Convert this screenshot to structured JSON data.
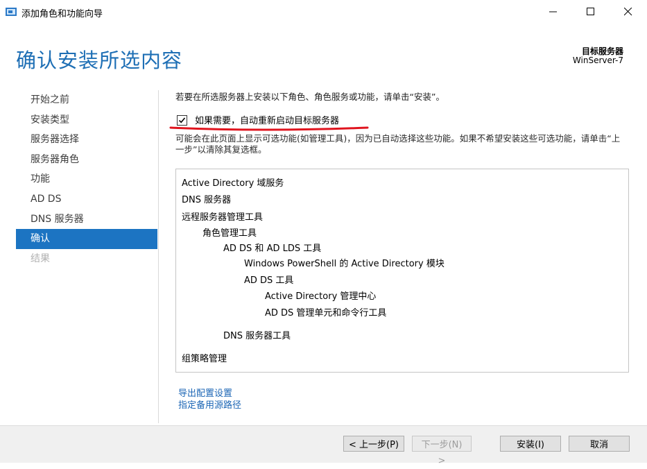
{
  "window": {
    "title": "添加角色和功能向导"
  },
  "header": {
    "page_title": "确认安装所选内容",
    "target_label": "目标服务器",
    "target_value": "WinServer-7"
  },
  "nav": {
    "items": [
      {
        "label": "开始之前",
        "state": "normal"
      },
      {
        "label": "安装类型",
        "state": "normal"
      },
      {
        "label": "服务器选择",
        "state": "normal"
      },
      {
        "label": "服务器角色",
        "state": "normal"
      },
      {
        "label": "功能",
        "state": "normal"
      },
      {
        "label": "AD DS",
        "state": "normal"
      },
      {
        "label": "DNS 服务器",
        "state": "normal"
      },
      {
        "label": "确认",
        "state": "active"
      },
      {
        "label": "结果",
        "state": "disabled"
      }
    ]
  },
  "main": {
    "intro": "若要在所选服务器上安装以下角色、角色服务或功能，请单击“安装”。",
    "restart_checkbox": {
      "label": "如果需要，自动重新启动目标服务器",
      "checked": true
    },
    "note": "可能会在此页面上显示可选功能(如管理工具)，因为已自动选择这些功能。如果不希望安装这些可选功能，请单击“上一步”以清除其复选框。",
    "items": [
      {
        "label": "Active Directory 域服务",
        "level": 0
      },
      {
        "label": "DNS 服务器",
        "level": 0
      },
      {
        "label": "远程服务器管理工具",
        "level": 0
      },
      {
        "label": "角色管理工具",
        "level": 1
      },
      {
        "label": "AD DS 和 AD LDS 工具",
        "level": 2
      },
      {
        "label": "Windows PowerShell 的 Active Directory 模块",
        "level": 3
      },
      {
        "label": "AD DS 工具",
        "level": 3
      },
      {
        "label": "Active Directory 管理中心",
        "level": 4
      },
      {
        "label": "AD DS 管理单元和命令行工具",
        "level": 4
      },
      {
        "label": "DNS 服务器工具",
        "level": 2
      },
      {
        "label": "组策略管理",
        "level": 0
      }
    ],
    "links": {
      "export": "导出配置设置",
      "alt_source": "指定备用源路径"
    }
  },
  "footer": {
    "prev": "< 上一步(P)",
    "next": "下一步(N) >",
    "install": "安装(I)",
    "cancel": "取消"
  },
  "colors": {
    "accent": "#1c74c2",
    "title": "#1e6fb5",
    "highlight_mark": "#e0141e"
  }
}
